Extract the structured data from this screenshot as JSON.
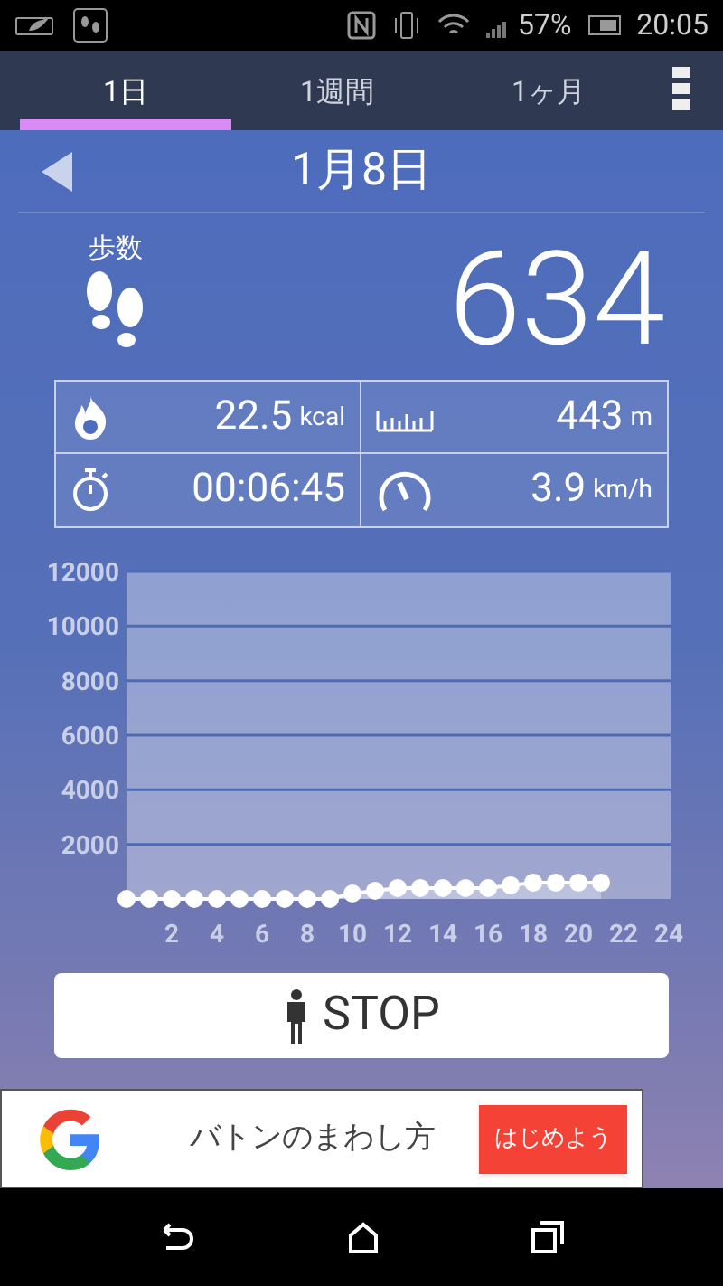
{
  "status_bar": {
    "battery": "57%",
    "time": "20:05"
  },
  "tabs": [
    {
      "label": "1日",
      "selected": true
    },
    {
      "label": "1週間",
      "selected": false
    },
    {
      "label": "1ヶ月",
      "selected": false
    }
  ],
  "date": "1月8日",
  "steps": {
    "label": "歩数",
    "value": "634"
  },
  "stats": [
    {
      "kind": "calories",
      "value": "22.5",
      "unit": "kcal"
    },
    {
      "kind": "distance",
      "value": "443",
      "unit": "m"
    },
    {
      "kind": "time",
      "value": "00:06:45"
    },
    {
      "kind": "speed",
      "value": "3.9",
      "unit": "km/h"
    }
  ],
  "chart_data": {
    "type": "area",
    "x": [
      0,
      1,
      2,
      3,
      4,
      5,
      6,
      7,
      8,
      9,
      10,
      11,
      12,
      13,
      14,
      15,
      16,
      17,
      18,
      19,
      20,
      21
    ],
    "series": [
      {
        "color": "#ffffff",
        "values": [
          0,
          0,
          0,
          0,
          0,
          0,
          0,
          0,
          0,
          0,
          200,
          300,
          400,
          400,
          400,
          400,
          400,
          500,
          600,
          600,
          600,
          600
        ]
      }
    ],
    "grid": true,
    "xlim": [
      0,
      24
    ],
    "ylim": [
      0,
      12000
    ],
    "xticks": [
      2,
      4,
      6,
      8,
      10,
      12,
      14,
      16,
      18,
      20,
      22,
      24
    ],
    "yticks": [
      2000,
      4000,
      6000,
      8000,
      10000,
      12000
    ]
  },
  "stop_button": "STOP",
  "ad": {
    "text": "バトンのまわし方",
    "button": "はじめよう"
  }
}
